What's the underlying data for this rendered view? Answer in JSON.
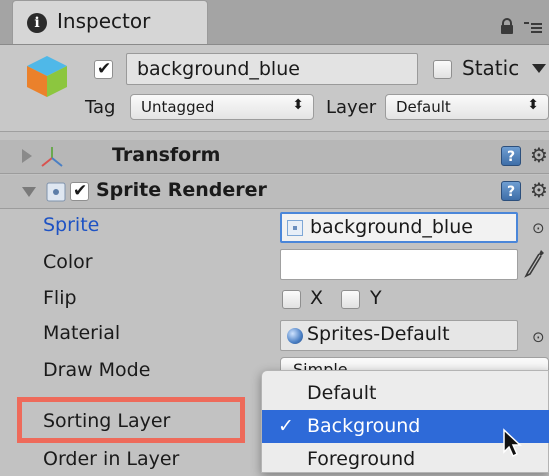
{
  "tab": {
    "title": "Inspector"
  },
  "object": {
    "name": "background_blue",
    "active": true,
    "static_label": "Static",
    "static_checked": false
  },
  "tag": {
    "label": "Tag",
    "value": "Untagged"
  },
  "layer": {
    "label": "Layer",
    "value": "Default"
  },
  "components": {
    "transform": {
      "title": "Transform"
    },
    "sprite_renderer": {
      "title": "Sprite Renderer",
      "enabled": true
    }
  },
  "properties": {
    "sprite": {
      "label": "Sprite",
      "value": "background_blue"
    },
    "color": {
      "label": "Color",
      "value": "#ffffff"
    },
    "flip": {
      "label": "Flip",
      "x_label": "X",
      "y_label": "Y",
      "x": false,
      "y": false
    },
    "material": {
      "label": "Material",
      "value": "Sprites-Default"
    },
    "draw_mode": {
      "label": "Draw Mode",
      "value": "Simple"
    },
    "sorting_layer": {
      "label": "Sorting Layer"
    },
    "order_in_layer": {
      "label": "Order in Layer"
    }
  },
  "sorting_layer_menu": {
    "options": [
      "Default",
      "Background",
      "Foreground"
    ],
    "selected": "Background"
  },
  "colors": {
    "highlight_outline": "#ee6a5a",
    "menu_selection": "#2e6ad8",
    "sprite_label": "#1d52c4"
  }
}
